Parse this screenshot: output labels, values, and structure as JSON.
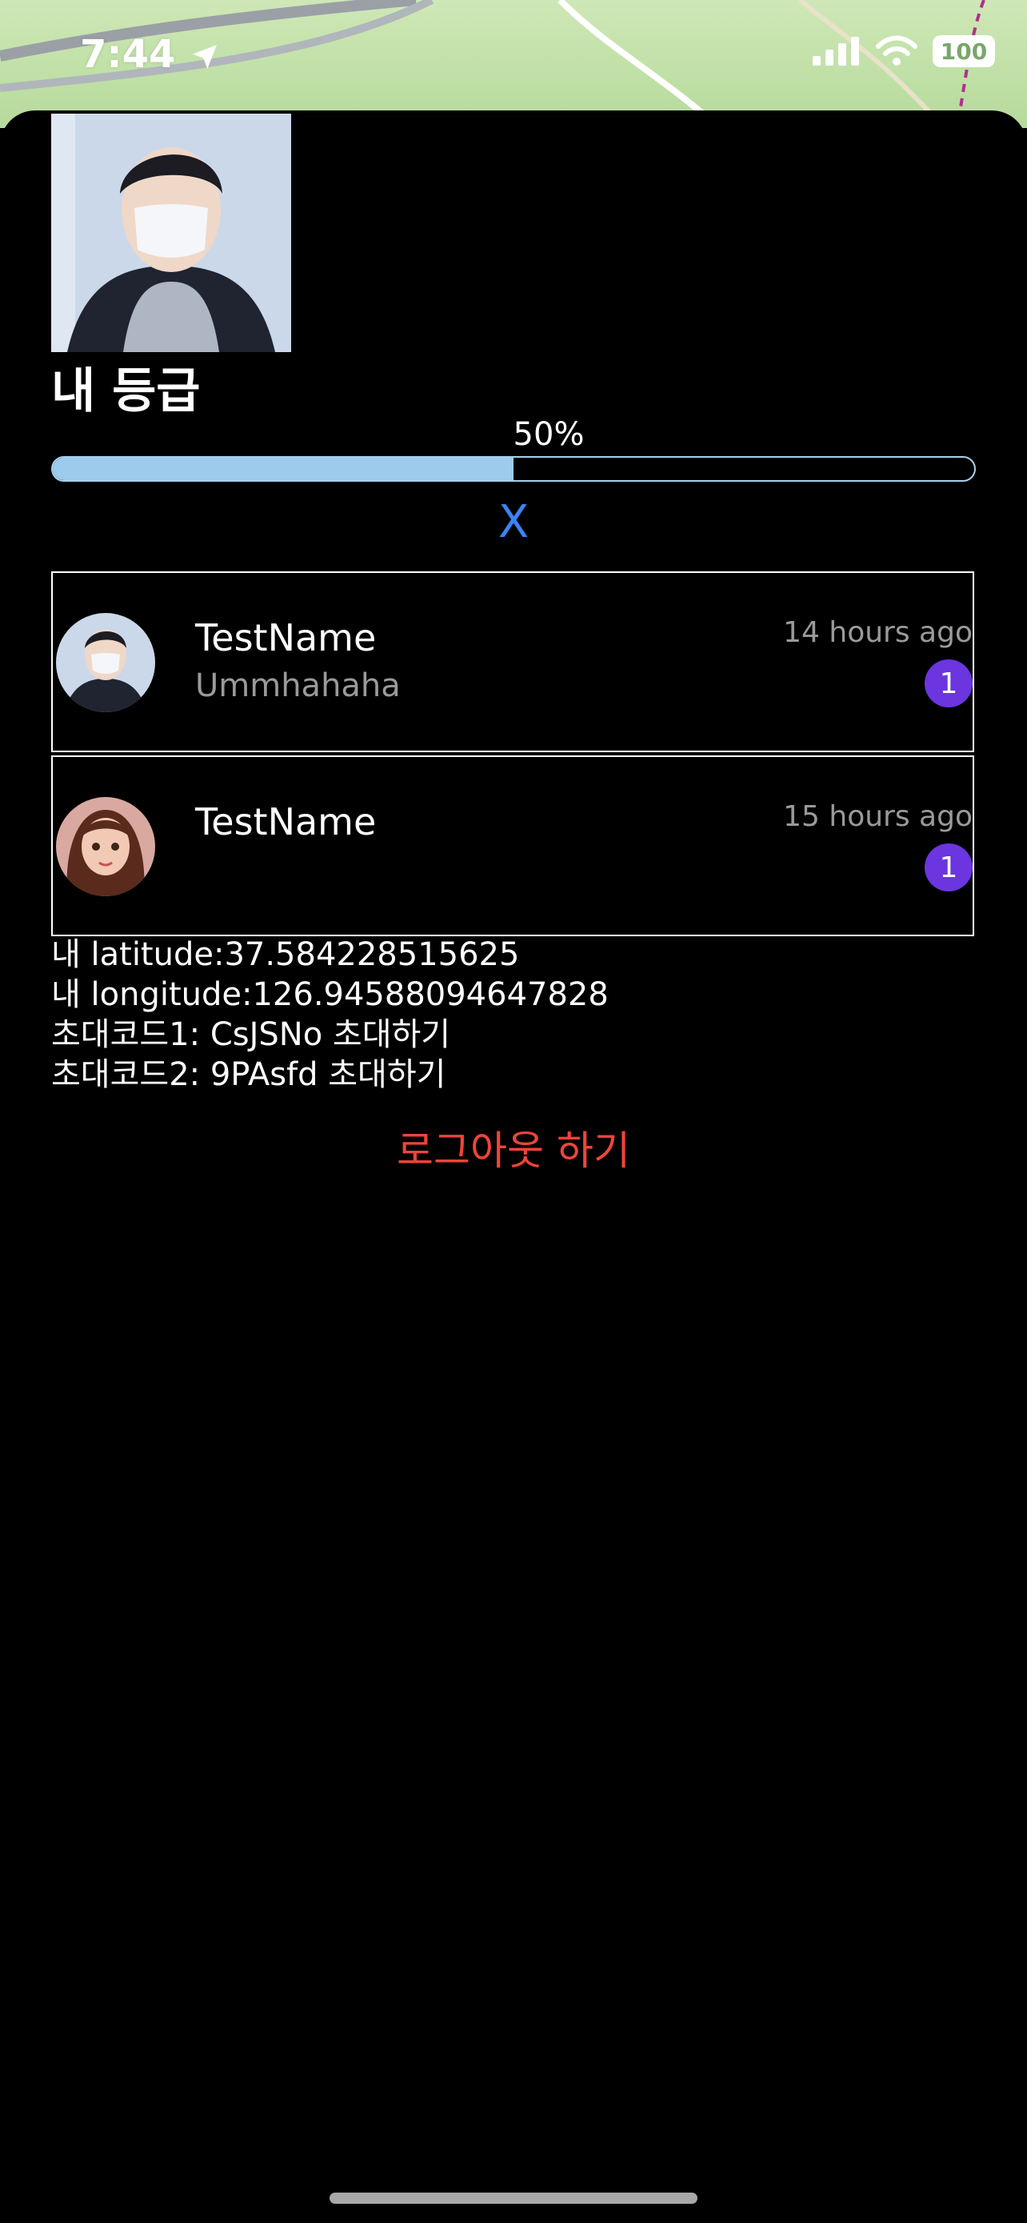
{
  "status_bar": {
    "time": "7:44",
    "battery": "100",
    "icons": [
      "location-arrow-icon",
      "cellular-signal-icon",
      "wifi-icon",
      "battery-icon"
    ]
  },
  "profile": {
    "grade_title": "내 등급",
    "progress_label": "50%",
    "progress_value": 0.5,
    "close_label": "X"
  },
  "chats": [
    {
      "name": "TestName",
      "preview": "Ummhahaha",
      "time": "14 hours ago",
      "badge": "1"
    },
    {
      "name": "TestName",
      "preview": "",
      "time": "15 hours ago",
      "badge": "1"
    }
  ],
  "info": {
    "latitude": "내 latitude:37.584228515625",
    "longitude": "내 longitude:126.94588094647828",
    "invite1": "초대코드1: CsJSNo 초대하기",
    "invite2": "초대코드2: 9PAsfd 초대하기"
  },
  "logout_label": "로그아웃 하기",
  "colors": {
    "accent_blue": "#3a83f7",
    "progress_fill": "#9ccbec",
    "badge_purple": "#6b35df",
    "logout_red": "#f0443a"
  }
}
